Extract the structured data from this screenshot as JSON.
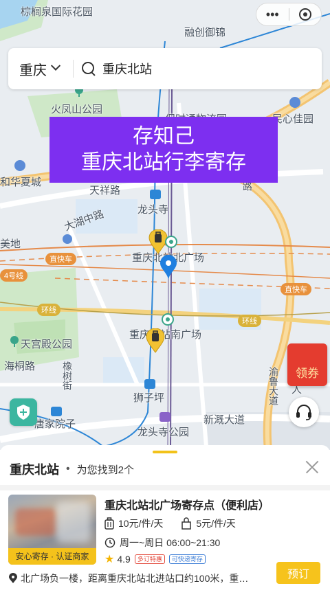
{
  "map": {
    "labels": [
      {
        "key": "l1",
        "text": "棕榈泉国际花园"
      },
      {
        "key": "l2",
        "text": "融创御锦"
      },
      {
        "key": "l3",
        "text": "火凤山公园"
      },
      {
        "key": "l4",
        "text": "保时通物流园"
      },
      {
        "key": "l5",
        "text": "民心佳园"
      },
      {
        "key": "l6",
        "text": "和华夏城"
      },
      {
        "key": "l7",
        "text": "天祥路"
      },
      {
        "key": "l8",
        "text": "龙头寺"
      },
      {
        "key": "l9",
        "text": "大湖中路"
      },
      {
        "key": "l10",
        "text": "美地"
      },
      {
        "key": "l11",
        "text": "重庆北站北广场"
      },
      {
        "key": "l12",
        "text": "重庆北站南广场"
      },
      {
        "key": "l13",
        "text": "天宫殿公园"
      },
      {
        "key": "l14",
        "text": "海桐路"
      },
      {
        "key": "l15",
        "text": "橡树街"
      },
      {
        "key": "l16",
        "text": "狮子坪"
      },
      {
        "key": "l17",
        "text": "唐家院子"
      },
      {
        "key": "l18",
        "text": "龙头寺公园"
      },
      {
        "key": "l19",
        "text": "新溉大道"
      },
      {
        "key": "l20",
        "text": "渝鲁大道"
      },
      {
        "key": "l21",
        "text": "快速路"
      },
      {
        "key": "l22",
        "text": "人"
      }
    ],
    "badges": {
      "zhikuaiche1": "直快车",
      "zhikuaiche2": "直快车",
      "line4": "4号线",
      "huanxian1": "环线",
      "huanxian2": "环线"
    }
  },
  "search": {
    "city": "重庆",
    "query": "重庆北站"
  },
  "banner": {
    "line1": "存知己",
    "line2": "重庆北站行李寄存"
  },
  "coupon": {
    "label": "领券"
  },
  "results": {
    "title": "重庆北站",
    "count_text": "为您找到2个"
  },
  "store": {
    "name": "重庆北站北广场寄存点（便利店）",
    "thumb_tag": "安心寄存 · 认证商家",
    "price_large": "10元/件/天",
    "price_small": "5元/件/天",
    "hours": "周一~周日 06:00~21:30",
    "rating": "4.9",
    "tag1": "多订特惠",
    "tag2": "可快递寄存",
    "address": "北广场负一楼，距离重庆北站北进站口约100米，重…",
    "book_label": "预订"
  },
  "colors": {
    "accent": "#f6c31c",
    "banner": "#7d2ff0",
    "pin_blue": "#1e7fe0"
  }
}
